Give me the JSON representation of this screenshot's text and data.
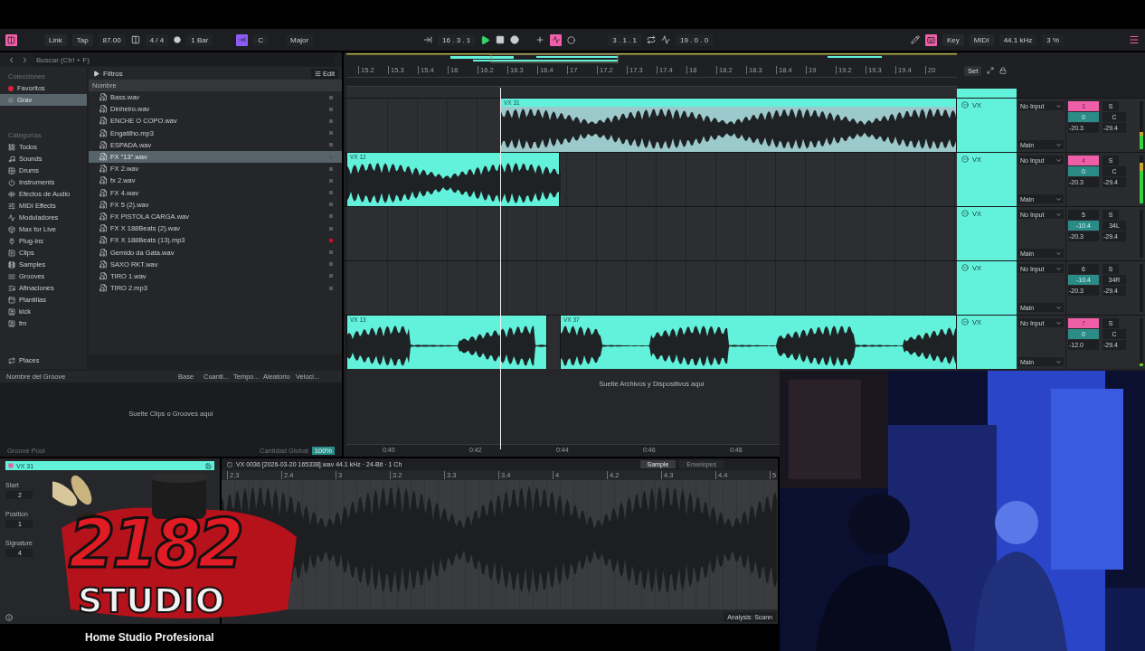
{
  "toolbar": {
    "link": "Link",
    "tap": "Tap",
    "tempo": "87.00",
    "time_signature": "4 / 4",
    "quantize": "1 Bar",
    "key": "C",
    "scale": "Major",
    "arrangement_position": "16 . 3 . 1",
    "loop_start": "3 . 1 . 1",
    "loop_length": "19 . 0 . 0",
    "key_map": "Key",
    "midi_map": "MIDI",
    "sample_rate": "44.1 kHz",
    "cpu_load": "3 %"
  },
  "browser": {
    "search_placeholder": "Buscar (Ctrl + F)",
    "collections_heading": "Colecciones",
    "collections": [
      {
        "label": "Favoritos",
        "color": "#d8233a",
        "selected": false
      },
      {
        "label": "Grav",
        "color": "#6f7c82",
        "selected": true
      }
    ],
    "categories_heading": "Categorías",
    "categories": [
      {
        "label": "Todos"
      },
      {
        "label": "Sounds"
      },
      {
        "label": "Drums"
      },
      {
        "label": "Instruments"
      },
      {
        "label": "Efectos de Audio"
      },
      {
        "label": "MIDI Effects"
      },
      {
        "label": "Moduladores"
      },
      {
        "label": "Max for Live"
      },
      {
        "label": "Plug-ins"
      },
      {
        "label": "Clips"
      },
      {
        "label": "Samples"
      },
      {
        "label": "Grooves"
      },
      {
        "label": "Afinaciones"
      },
      {
        "label": "Plantillas"
      },
      {
        "label": "kick"
      },
      {
        "label": "fm"
      }
    ],
    "places": "Places",
    "filters": "Filtros",
    "edit": "Edit",
    "name_column": "Nombre",
    "files": [
      {
        "name": "Bass.wav",
        "selected": false,
        "color": "#55595e"
      },
      {
        "name": "Dinheiro.wav",
        "selected": false,
        "color": "#55595e"
      },
      {
        "name": "ENCHE O COPO.wav",
        "selected": false,
        "color": "#55595e"
      },
      {
        "name": "Engatilho.mp3",
        "selected": false,
        "color": "#55595e"
      },
      {
        "name": "ESPADA.wav",
        "selected": false,
        "color": "#55595e"
      },
      {
        "name": "FX \"13\".wav",
        "selected": true,
        "color": "#55595e"
      },
      {
        "name": "FX 2.wav",
        "selected": false,
        "color": "#55595e"
      },
      {
        "name": "fx 2.wav",
        "selected": false,
        "color": "#55595e"
      },
      {
        "name": "FX 4.wav",
        "selected": false,
        "color": "#55595e"
      },
      {
        "name": "FX 5 (2).wav",
        "selected": false,
        "color": "#55595e"
      },
      {
        "name": "FX PISTOLA CARGA.wav",
        "selected": false,
        "color": "#55595e"
      },
      {
        "name": "FX X 188Beats (2).wav",
        "selected": false,
        "color": "#55595e"
      },
      {
        "name": "FX X 188Beats (13).mp3",
        "selected": false,
        "color": "#c8102e"
      },
      {
        "name": "Gemido da Gata.wav",
        "selected": false,
        "color": "#55595e"
      },
      {
        "name": "SAXO RKT.wav",
        "selected": false,
        "color": "#55595e"
      },
      {
        "name": "TIRO 1.wav",
        "selected": false,
        "color": "#55595e"
      },
      {
        "name": "TIRO 2.mp3",
        "selected": false,
        "color": "#55595e"
      }
    ]
  },
  "groove_pool": {
    "columns": [
      "Nombre del Groove",
      "Base",
      "Cuanti...",
      "Tempo...",
      "Aleatorio",
      "Veloci..."
    ],
    "empty_text": "Suelte Clips o Grooves aquí",
    "title": "Groove Pool",
    "global_amount_label": "Cantidad Global",
    "global_amount": "100%"
  },
  "arrangement": {
    "ruler": [
      "15.2",
      "15.3",
      "15.4",
      "16",
      "16.2",
      "16.3",
      "16.4",
      "17",
      "17.2",
      "17.3",
      "17.4",
      "18",
      "18.2",
      "18.3",
      "18.4",
      "19",
      "19.2",
      "19.3",
      "19.4",
      "20"
    ],
    "set_button": "Set",
    "drop_text": "Suelte Archivos y Dispositivos aquí",
    "time_ruler": [
      "0:40",
      "0:42",
      "0:44",
      "0:46",
      "0:48"
    ],
    "tracks": [
      {
        "name": "VX",
        "input": "No Input",
        "output": "Main",
        "number": "3",
        "active": true,
        "solo": "S",
        "volume": "0",
        "pan": "C",
        "send_a": "-20.3",
        "send_b": "-29.4",
        "meter": {
          "level": 0.35
        },
        "clips": [
          {
            "name": "VX 31",
            "selected": true
          }
        ]
      },
      {
        "name": "VX",
        "input": "No Input",
        "output": "Main",
        "number": "4",
        "active": true,
        "solo": "S",
        "volume": "0",
        "pan": "C",
        "send_a": "-20.3",
        "send_b": "-29.4",
        "meter": {
          "level": 0.85
        },
        "clips": [
          {
            "name": "VX 12",
            "selected": false
          }
        ]
      },
      {
        "name": "VX",
        "input": "No Input",
        "output": "Main",
        "number": "5",
        "active": false,
        "solo": "S",
        "volume": "-10.4",
        "pan": "34L",
        "send_a": "-20.3",
        "send_b": "-29.4",
        "meter": {
          "level": 0
        }
      },
      {
        "name": "VX",
        "input": "No Input",
        "output": "Main",
        "number": "6",
        "active": false,
        "solo": "S",
        "volume": "-10.4",
        "pan": "34R",
        "send_a": "-20.3",
        "send_b": "-29.4",
        "meter": {
          "level": 0
        }
      },
      {
        "name": "VX",
        "input": "No Input",
        "output": "Main",
        "number": "7",
        "active": true,
        "solo": "S",
        "volume": "0",
        "pan": "C",
        "send_a": "-12.0",
        "send_b": "-29.4",
        "meter": {
          "level": 0.06
        },
        "clips": [
          {
            "name": "VX 13",
            "selected": false
          },
          {
            "name": "VX 37",
            "selected": false
          }
        ]
      }
    ]
  },
  "clip_detail": {
    "clip_name": "VX 31",
    "file_info": "VX 0036 [2026-03-20 165338].wav  44.1 kHz · 24-Bit · 1 Ch",
    "tabs": [
      {
        "label": "Sample",
        "selected": true
      },
      {
        "label": "Envelopes",
        "selected": false
      }
    ],
    "ruler": [
      "2.3",
      "2.4",
      "3",
      "3.2",
      "3.3",
      "3.4",
      "4",
      "4.2",
      "4.3",
      "4.4",
      "5"
    ],
    "fields": [
      {
        "label": "Start",
        "value": "2"
      },
      {
        "label": "Position",
        "value": "1"
      },
      {
        "label": "Signature",
        "value": "4"
      }
    ],
    "analysis": "Analysis: Scann"
  },
  "logo": {
    "title": "2182",
    "subtitle": "STUDIO",
    "tagline": "Home Studio Profesional"
  }
}
